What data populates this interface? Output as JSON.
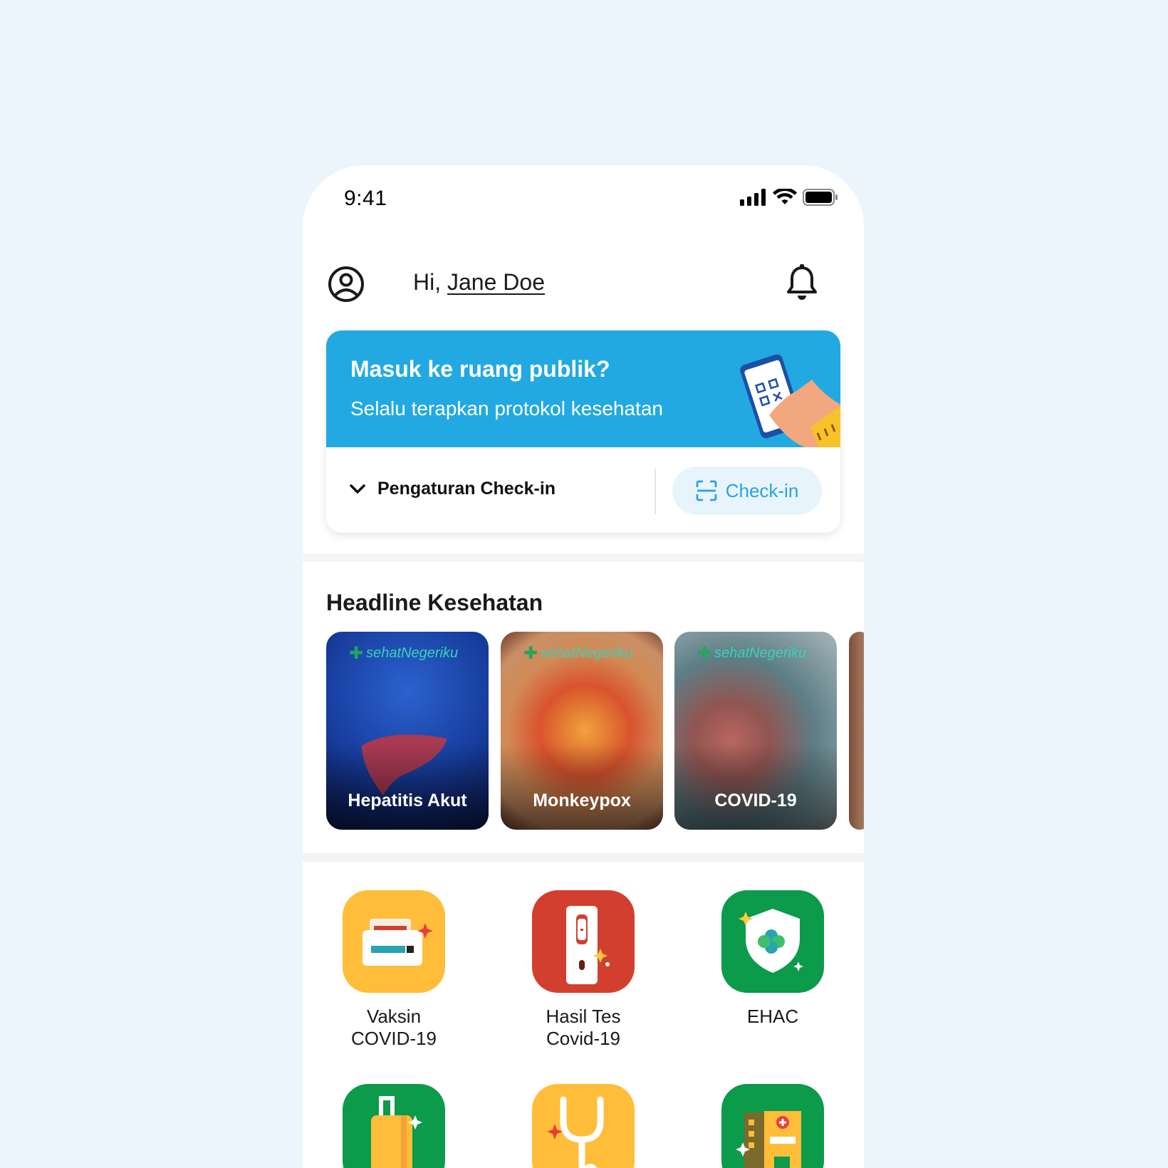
{
  "status_bar": {
    "time": "9:41"
  },
  "header": {
    "greeting": "Hi,",
    "user_name": "Jane Doe"
  },
  "checkin_card": {
    "title": "Masuk ke ruang publik?",
    "subtitle": "Selalu terapkan protokol kesehatan",
    "settings_label": "Pengaturan Check-in",
    "button_label": "Check-in"
  },
  "headlines": {
    "title": "Headline Kesehatan",
    "brand": "sehatNegeriku",
    "items": [
      {
        "label": "Hepatitis Akut"
      },
      {
        "label": "Monkeypox"
      },
      {
        "label": "COVID-19"
      }
    ]
  },
  "menu": {
    "items": [
      {
        "label": "Vaksin\nCOVID-19",
        "icon": "vaccine-card-icon",
        "color": "#ffbd3a"
      },
      {
        "label": "Hasil Tes\nCovid-19",
        "icon": "test-kit-icon",
        "color": "#d33f2f"
      },
      {
        "label": "EHAC",
        "icon": "shield-icon",
        "color": "#0c9a4b"
      },
      {
        "label": "",
        "icon": "luggage-icon",
        "color": "#0c9a4b"
      },
      {
        "label": "",
        "icon": "stethoscope-icon",
        "color": "#ffbd3a"
      },
      {
        "label": "",
        "icon": "hospital-icon",
        "color": "#0c9a4b"
      }
    ]
  },
  "colors": {
    "primary": "#22a9e1",
    "background": "#ecf5fd"
  }
}
